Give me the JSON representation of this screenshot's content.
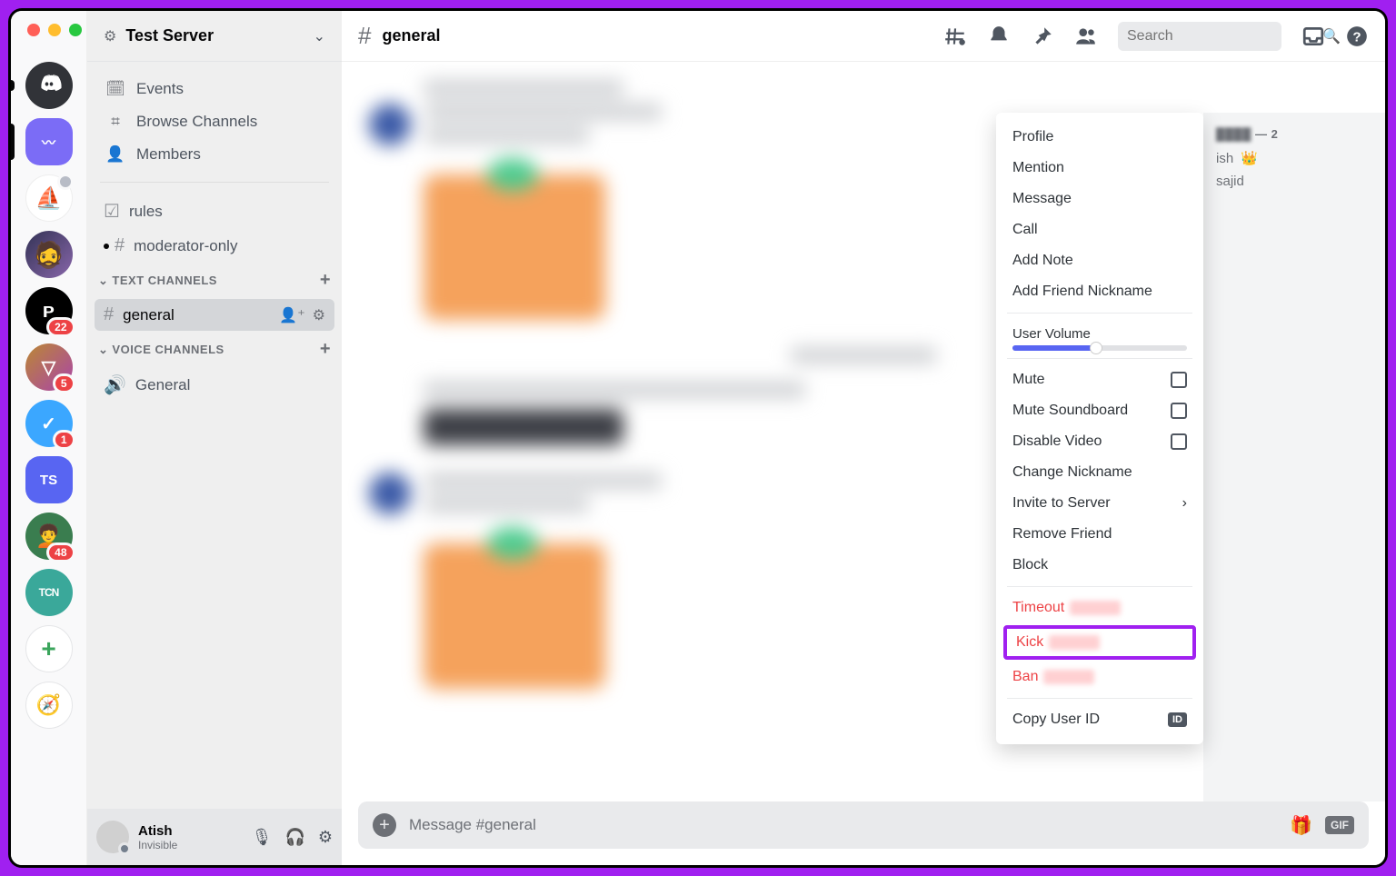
{
  "server_rail": {
    "servers": [
      {
        "id": "home",
        "color": "#313338",
        "label": "",
        "selected": false,
        "pill": "sm"
      },
      {
        "id": "s1",
        "color": "#7b6cf6",
        "label": "〰",
        "selected": true,
        "pill": "full"
      },
      {
        "id": "s2",
        "color": "#ffffff",
        "label": "⛵",
        "sub_badge": true
      },
      {
        "id": "s3",
        "color": "#334766",
        "label": "🧙"
      },
      {
        "id": "s4",
        "color": "#000000",
        "label": "P",
        "badge": "22"
      },
      {
        "id": "s5",
        "color": "#2b2d31",
        "label": "▽",
        "badge": "5"
      },
      {
        "id": "s6",
        "color": "#3ba7ff",
        "label": "✔",
        "badge": "1"
      },
      {
        "id": "s7",
        "color": "#5865f2",
        "label": "TS",
        "rounded": true
      },
      {
        "id": "s8",
        "color": "#3a7d4f",
        "label": "👤",
        "badge": "48"
      },
      {
        "id": "s9",
        "color": "#3aa89a",
        "label": "TCN"
      }
    ],
    "add_label": "+",
    "explore_label": "🧭"
  },
  "server_header": {
    "name": "Test Server"
  },
  "sidebar": {
    "top_items": [
      {
        "icon": "📅",
        "label": "Events"
      },
      {
        "icon": "#",
        "label": "Browse Channels"
      },
      {
        "icon": "👥",
        "label": "Members"
      }
    ],
    "pinned_channels": [
      {
        "icon": "☑",
        "label": "rules"
      },
      {
        "icon": "#🔒",
        "label": "moderator-only",
        "dot": true
      }
    ],
    "text_category": "TEXT CHANNELS",
    "text_channels": [
      {
        "name": "general",
        "active": true
      }
    ],
    "voice_category": "VOICE CHANNELS",
    "voice_channels": [
      {
        "name": "General"
      }
    ]
  },
  "user_panel": {
    "name": "Atish",
    "status": "Invisible"
  },
  "channel_header": {
    "name": "general",
    "search_placeholder": "Search"
  },
  "composer": {
    "placeholder": "Message #general"
  },
  "members_panel": {
    "count_suffix": "2",
    "rows": [
      {
        "name_suffix": "ish",
        "crown": true
      },
      {
        "name_suffix": "sajid"
      }
    ]
  },
  "context_menu": {
    "items_top": [
      "Profile",
      "Mention",
      "Message",
      "Call",
      "Add Note",
      "Add Friend Nickname"
    ],
    "volume_label": "User Volume",
    "toggles": [
      {
        "label": "Mute",
        "checkbox": true
      },
      {
        "label": "Mute Soundboard",
        "checkbox": true
      },
      {
        "label": "Disable Video",
        "checkbox": true
      },
      {
        "label": "Change Nickname"
      },
      {
        "label": "Invite to Server",
        "chevron": true
      },
      {
        "label": "Remove Friend"
      },
      {
        "label": "Block"
      }
    ],
    "danger": [
      {
        "label": "Timeout"
      },
      {
        "label": "Kick",
        "highlighted": true
      },
      {
        "label": "Ban"
      }
    ],
    "copy_id": "Copy User ID"
  }
}
